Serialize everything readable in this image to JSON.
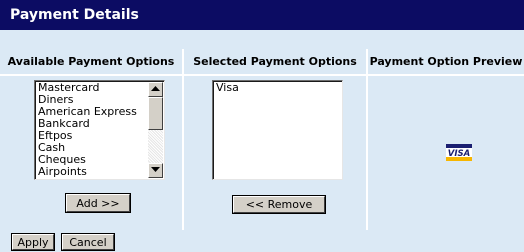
{
  "window": {
    "title": "Payment Details"
  },
  "columns": {
    "available": {
      "header": "Available Payment Options"
    },
    "selected": {
      "header": "Selected Payment Options"
    },
    "preview": {
      "header": "Payment Option Preview"
    }
  },
  "available_list": {
    "items": [
      "Mastercard",
      "Diners",
      "American Express",
      "Bankcard",
      "Eftpos",
      "Cash",
      "Cheques",
      "Airpoints"
    ]
  },
  "selected_list": {
    "items": [
      "Visa"
    ]
  },
  "buttons": {
    "add": "Add >>",
    "remove": "<< Remove",
    "apply": "Apply",
    "cancel": "Cancel"
  },
  "preview": {
    "logo_text": "VISA",
    "logo_colors": {
      "top": "#1a1f71",
      "text": "#1a1f71",
      "bottom": "#f7b600"
    }
  }
}
